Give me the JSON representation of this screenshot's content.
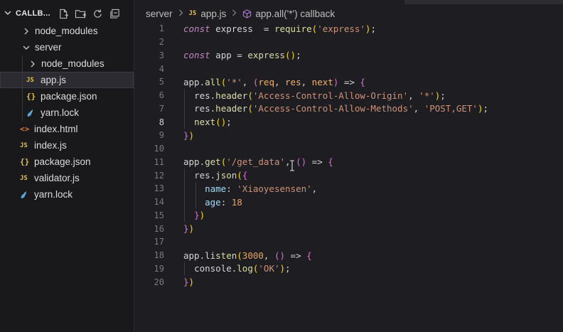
{
  "explorer": {
    "title": "CALLB...",
    "actions": [
      "new-file-icon",
      "new-folder-icon",
      "refresh-icon",
      "collapse-icon"
    ],
    "items": [
      {
        "label": "node_modules",
        "type": "folder",
        "expanded": false,
        "depth": 0
      },
      {
        "label": "server",
        "type": "folder",
        "expanded": true,
        "depth": 0
      },
      {
        "label": "node_modules",
        "type": "folder",
        "expanded": false,
        "depth": 1
      },
      {
        "label": "app.js",
        "type": "js",
        "depth": 1,
        "selected": true
      },
      {
        "label": "package.json",
        "type": "json",
        "depth": 1
      },
      {
        "label": "yarn.lock",
        "type": "yarn",
        "depth": 1
      },
      {
        "label": "index.html",
        "type": "html",
        "depth": 0
      },
      {
        "label": "index.js",
        "type": "js",
        "depth": 0
      },
      {
        "label": "package.json",
        "type": "json",
        "depth": 0
      },
      {
        "label": "validator.js",
        "type": "js",
        "depth": 0
      },
      {
        "label": "yarn.lock",
        "type": "yarn",
        "depth": 0
      }
    ]
  },
  "breadcrumb": {
    "folder": "server",
    "file": "app.js",
    "symbol": "app.all('*') callback"
  },
  "icons": {
    "js_badge": "JS",
    "json_badge": "{}",
    "html_badge": "<>"
  },
  "editor": {
    "active_line": 8,
    "lines": [
      "const express  = require('express');",
      "",
      "const app = express();",
      "",
      "app.all('*', (req, res, next) => {",
      "  res.header('Access-Control-Allow-Origin', '*');",
      "  res.header('Access-Control-Allow-Methods', 'POST,GET');",
      "  next();",
      "})",
      "",
      "app.get('/get_data', () => {",
      "  res.json({",
      "    name: 'Xiaoyesensen',",
      "    age: 18",
      "  })",
      "})",
      "",
      "app.listen(3000, () => {",
      "  console.log('OK');",
      "})"
    ]
  },
  "colors": {
    "background": "#1e1e22",
    "sidebar": "#19191c",
    "keyword": "#c586c0",
    "function": "#dcdcaa",
    "string": "#ce9178",
    "number": "#e5a55c",
    "js_icon": "#e2c24b"
  }
}
